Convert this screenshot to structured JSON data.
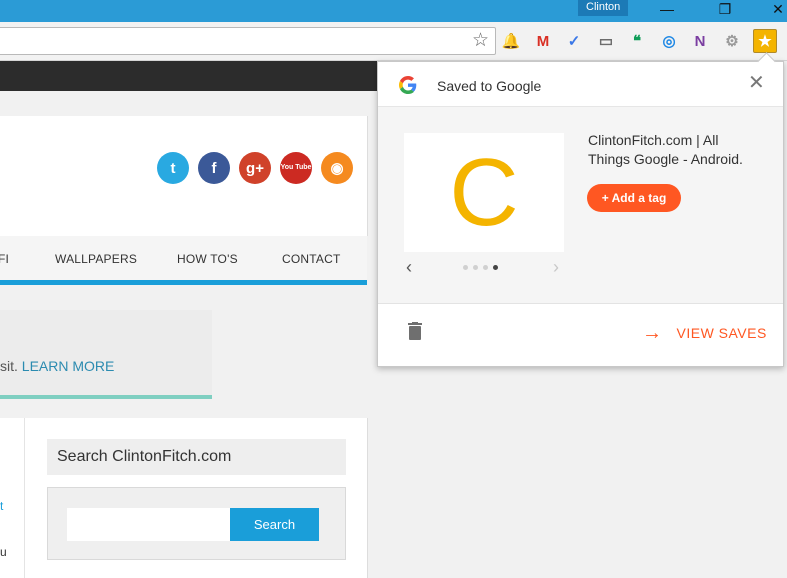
{
  "window": {
    "user_badge": "Clinton",
    "minimize_label": "—",
    "restore_label": "❐",
    "close_label": "✕"
  },
  "toolbar": {
    "bookmark_star": "☆",
    "extensions": [
      {
        "name": "notifications-icon",
        "glyph": "🔔",
        "color": "#9e9e9e"
      },
      {
        "name": "gmail-icon",
        "glyph": "M",
        "color": "#d93025"
      },
      {
        "name": "check-icon",
        "glyph": "✓",
        "color": "#3b78e7"
      },
      {
        "name": "cast-icon",
        "glyph": "▭",
        "color": "#6c6c6c"
      },
      {
        "name": "hangouts-icon",
        "glyph": "❝",
        "color": "#0f9d58"
      },
      {
        "name": "ring-icon",
        "glyph": "◎",
        "color": "#1e88e5"
      },
      {
        "name": "onenote-icon",
        "glyph": "N",
        "color": "#7b3ea1"
      },
      {
        "name": "robot-icon",
        "glyph": "⚙",
        "color": "#9a9a9a"
      },
      {
        "name": "save-to-google-icon",
        "glyph": "★",
        "color": "#f4b400"
      }
    ]
  },
  "site": {
    "nav_items": [
      "FI",
      "WALLPAPERS",
      "HOW TO'S",
      "CONTACT"
    ],
    "social": [
      {
        "name": "twitter-icon",
        "glyph": "t",
        "color": "#29a9e1"
      },
      {
        "name": "facebook-icon",
        "glyph": "f",
        "color": "#3b5998"
      },
      {
        "name": "google-plus-icon",
        "glyph": "g+",
        "color": "#d0422a"
      },
      {
        "name": "youtube-icon",
        "glyph": "You Tube",
        "color": "#cc2a22"
      },
      {
        "name": "rss-icon",
        "glyph": "◉",
        "color": "#f58a1f"
      }
    ],
    "notice_text": "sit.",
    "notice_link": "LEARN MORE",
    "sidebar_fragments": [
      "t",
      "u"
    ],
    "search_title": "Search ClintonFitch.com",
    "search_button": "Search"
  },
  "popup": {
    "title": "Saved to Google",
    "close": "✕",
    "thumb_letter": "C",
    "page_title": "ClintonFitch.com | All Things Google - Android.",
    "add_tag": "+ Add a tag",
    "prev": "‹",
    "next": "›",
    "carousel_dots": 4,
    "active_dot": 4,
    "view_saves": "VIEW SAVES",
    "arrow": "→"
  },
  "colors": {
    "accent": "#ff5722",
    "site_blue": "#1a9ed9",
    "chrome_blue": "#2b9bd6"
  }
}
